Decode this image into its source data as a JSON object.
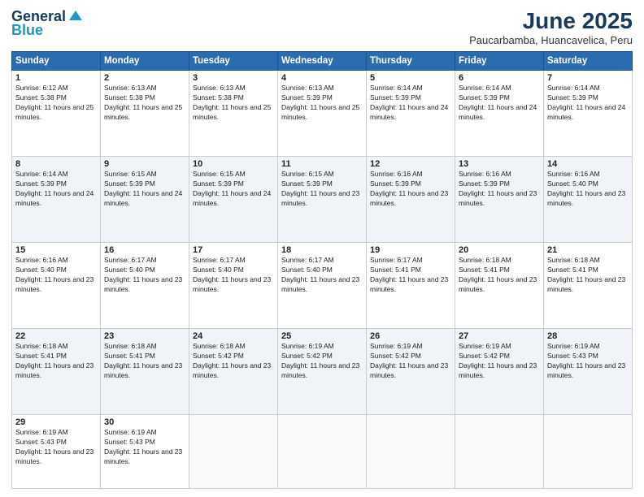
{
  "logo": {
    "line1": "General",
    "line2": "Blue"
  },
  "title": "June 2025",
  "subtitle": "Paucarbamba, Huancavelica, Peru",
  "days": [
    "Sunday",
    "Monday",
    "Tuesday",
    "Wednesday",
    "Thursday",
    "Friday",
    "Saturday"
  ],
  "weeks": [
    [
      {
        "day": "1",
        "rise": "6:12 AM",
        "set": "5:38 PM",
        "daylight": "11 hours and 25 minutes."
      },
      {
        "day": "2",
        "rise": "6:13 AM",
        "set": "5:38 PM",
        "daylight": "11 hours and 25 minutes."
      },
      {
        "day": "3",
        "rise": "6:13 AM",
        "set": "5:38 PM",
        "daylight": "11 hours and 25 minutes."
      },
      {
        "day": "4",
        "rise": "6:13 AM",
        "set": "5:39 PM",
        "daylight": "11 hours and 25 minutes."
      },
      {
        "day": "5",
        "rise": "6:14 AM",
        "set": "5:39 PM",
        "daylight": "11 hours and 24 minutes."
      },
      {
        "day": "6",
        "rise": "6:14 AM",
        "set": "5:39 PM",
        "daylight": "11 hours and 24 minutes."
      },
      {
        "day": "7",
        "rise": "6:14 AM",
        "set": "5:39 PM",
        "daylight": "11 hours and 24 minutes."
      }
    ],
    [
      {
        "day": "8",
        "rise": "6:14 AM",
        "set": "5:39 PM",
        "daylight": "11 hours and 24 minutes."
      },
      {
        "day": "9",
        "rise": "6:15 AM",
        "set": "5:39 PM",
        "daylight": "11 hours and 24 minutes."
      },
      {
        "day": "10",
        "rise": "6:15 AM",
        "set": "5:39 PM",
        "daylight": "11 hours and 24 minutes."
      },
      {
        "day": "11",
        "rise": "6:15 AM",
        "set": "5:39 PM",
        "daylight": "11 hours and 23 minutes."
      },
      {
        "day": "12",
        "rise": "6:16 AM",
        "set": "5:39 PM",
        "daylight": "11 hours and 23 minutes."
      },
      {
        "day": "13",
        "rise": "6:16 AM",
        "set": "5:39 PM",
        "daylight": "11 hours and 23 minutes."
      },
      {
        "day": "14",
        "rise": "6:16 AM",
        "set": "5:40 PM",
        "daylight": "11 hours and 23 minutes."
      }
    ],
    [
      {
        "day": "15",
        "rise": "6:16 AM",
        "set": "5:40 PM",
        "daylight": "11 hours and 23 minutes."
      },
      {
        "day": "16",
        "rise": "6:17 AM",
        "set": "5:40 PM",
        "daylight": "11 hours and 23 minutes."
      },
      {
        "day": "17",
        "rise": "6:17 AM",
        "set": "5:40 PM",
        "daylight": "11 hours and 23 minutes."
      },
      {
        "day": "18",
        "rise": "6:17 AM",
        "set": "5:40 PM",
        "daylight": "11 hours and 23 minutes."
      },
      {
        "day": "19",
        "rise": "6:17 AM",
        "set": "5:41 PM",
        "daylight": "11 hours and 23 minutes."
      },
      {
        "day": "20",
        "rise": "6:18 AM",
        "set": "5:41 PM",
        "daylight": "11 hours and 23 minutes."
      },
      {
        "day": "21",
        "rise": "6:18 AM",
        "set": "5:41 PM",
        "daylight": "11 hours and 23 minutes."
      }
    ],
    [
      {
        "day": "22",
        "rise": "6:18 AM",
        "set": "5:41 PM",
        "daylight": "11 hours and 23 minutes."
      },
      {
        "day": "23",
        "rise": "6:18 AM",
        "set": "5:41 PM",
        "daylight": "11 hours and 23 minutes."
      },
      {
        "day": "24",
        "rise": "6:18 AM",
        "set": "5:42 PM",
        "daylight": "11 hours and 23 minutes."
      },
      {
        "day": "25",
        "rise": "6:19 AM",
        "set": "5:42 PM",
        "daylight": "11 hours and 23 minutes."
      },
      {
        "day": "26",
        "rise": "6:19 AM",
        "set": "5:42 PM",
        "daylight": "11 hours and 23 minutes."
      },
      {
        "day": "27",
        "rise": "6:19 AM",
        "set": "5:42 PM",
        "daylight": "11 hours and 23 minutes."
      },
      {
        "day": "28",
        "rise": "6:19 AM",
        "set": "5:43 PM",
        "daylight": "11 hours and 23 minutes."
      }
    ],
    [
      {
        "day": "29",
        "rise": "6:19 AM",
        "set": "5:43 PM",
        "daylight": "11 hours and 23 minutes."
      },
      {
        "day": "30",
        "rise": "6:19 AM",
        "set": "5:43 PM",
        "daylight": "11 hours and 23 minutes."
      },
      null,
      null,
      null,
      null,
      null
    ]
  ]
}
